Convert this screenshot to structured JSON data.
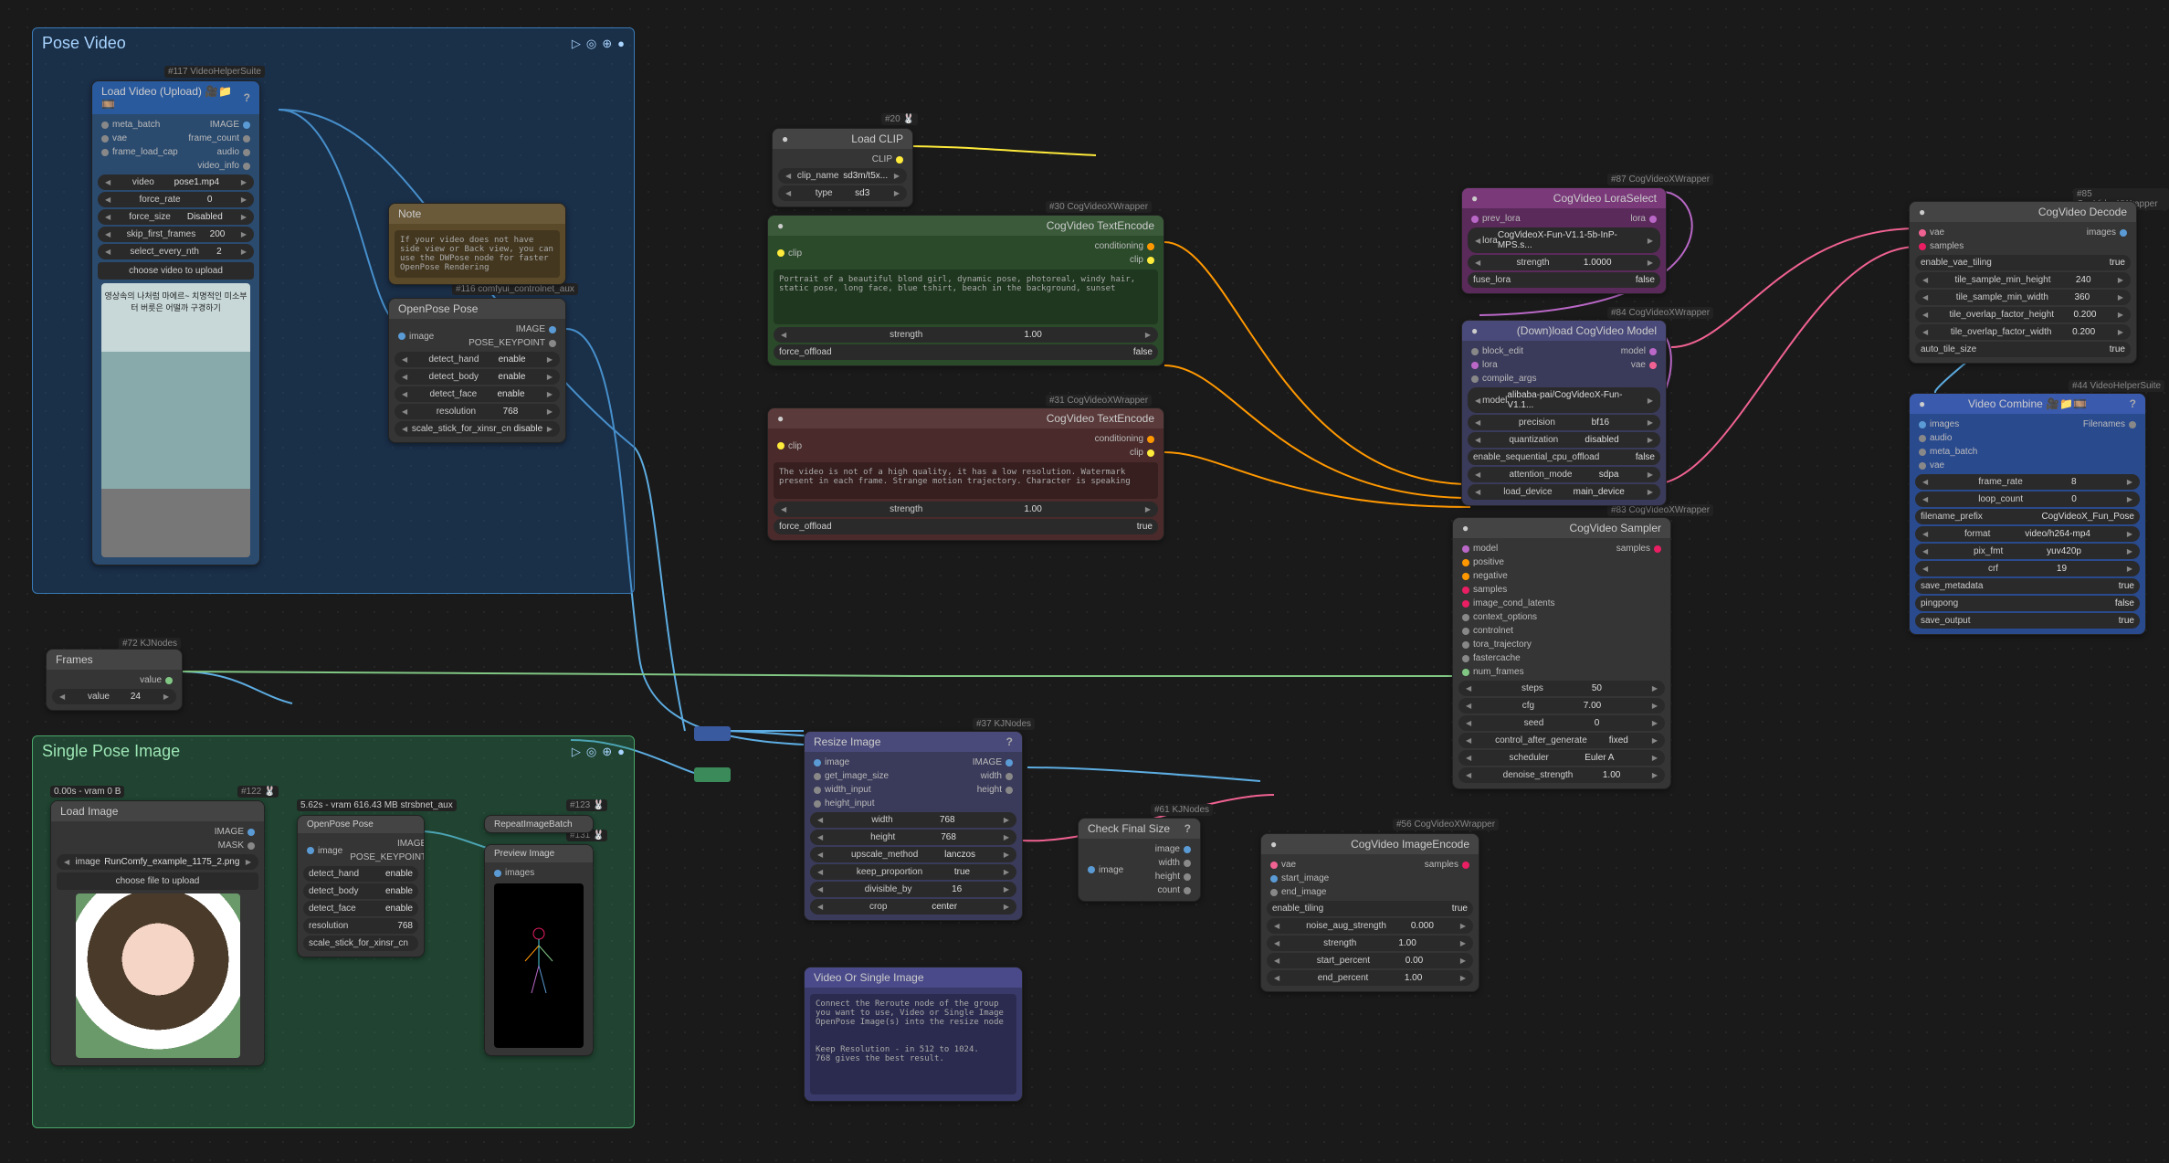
{
  "groups": {
    "pose_video": {
      "title": "Pose Video",
      "ctrl": [
        "▷",
        "◎",
        "⊕",
        "●"
      ]
    },
    "single_pose": {
      "title": "Single Pose Image",
      "ctrl": [
        "▷",
        "◎",
        "⊕",
        "●"
      ]
    }
  },
  "tags": {
    "t117": "#117 VideoHelperSuite",
    "t116": "#116 comfyui_controlnet_aux",
    "t72": "#72 KJNodes",
    "t122": "#122 🐰",
    "t123": "#123 🐰",
    "t131": "#131 🐰",
    "t37": "#37 KJNodes",
    "t61": "#61 KJNodes",
    "t20": "#20 🐰",
    "t30": "#30 CogVideoXWrapper",
    "t31": "#31 CogVideoXWrapper",
    "t87": "#87 CogVideoXWrapper",
    "t84": "#84 CogVideoXWrapper",
    "t83": "#83 CogVideoXWrapper",
    "t56": "#56 CogVideoXWrapper",
    "t85": "#85 CogVideoXWrapper",
    "t44": "#44 VideoHelperSuite",
    "vram": "0.00s - vram 0 B",
    "vram2": "5.62s - vram 616.43 MB  strsbnet_aux"
  },
  "load_video": {
    "title": "Load Video (Upload) 🎥📁🎞️",
    "q": "?",
    "in": [
      "meta_batch",
      "vae",
      "frame_load_cap"
    ],
    "out": [
      "IMAGE",
      "frame_count",
      "audio",
      "video_info"
    ],
    "w": [
      [
        "video",
        "pose1.mp4"
      ],
      [
        "force_rate",
        "0"
      ],
      [
        "force_size",
        "Disabled"
      ],
      [
        "skip_first_frames",
        "200"
      ],
      [
        "select_every_nth",
        "2"
      ]
    ],
    "btn": "choose video to upload",
    "caption": "영상속의 나처럼 마에르~  치명적인 미소부터 버릇은 어떨까 구경하기"
  },
  "openpose1": {
    "title": "OpenPose Pose",
    "in": [
      "image"
    ],
    "out": [
      "IMAGE",
      "POSE_KEYPOINT"
    ],
    "w": [
      [
        "detect_hand",
        "enable"
      ],
      [
        "detect_body",
        "enable"
      ],
      [
        "detect_face",
        "enable"
      ],
      [
        "resolution",
        "768"
      ],
      [
        "scale_stick_for_xinsr_cn",
        "disable"
      ]
    ]
  },
  "note": {
    "title": "Note",
    "text": "If your video does not have side view or Back view, you can use the DWPose node for faster OpenPose Rendering"
  },
  "frames": {
    "title": "Frames",
    "out": [
      "value"
    ],
    "w": [
      [
        "value",
        "24"
      ]
    ]
  },
  "load_image": {
    "title": "Load Image",
    "out": [
      "IMAGE",
      "MASK"
    ],
    "w": [
      [
        "image",
        "RunComfy_example_1175_2.png"
      ]
    ],
    "btn": "choose file to upload"
  },
  "openpose2": {
    "title": "OpenPose Pose",
    "in": [
      "image"
    ],
    "out": [
      "IMAGE",
      "POSE_KEYPOINT"
    ],
    "w": [
      [
        "detect_hand",
        "enable"
      ],
      [
        "detect_body",
        "enable"
      ],
      [
        "detect_face",
        "enable"
      ],
      [
        "resolution",
        "768"
      ],
      [
        "scale_stick_for_xinsr_cn",
        " "
      ]
    ]
  },
  "repeat": {
    "title": "RepeatImageBatch"
  },
  "preview": {
    "title": "Preview Image",
    "in": [
      "images"
    ]
  },
  "resize": {
    "title": "Resize Image",
    "q": "?",
    "in": [
      "image",
      "get_image_size",
      "width_input",
      "height_input"
    ],
    "out": [
      "IMAGE",
      "width",
      "height"
    ],
    "w": [
      [
        "width",
        "768"
      ],
      [
        "height",
        "768"
      ],
      [
        "upscale_method",
        "lanczos"
      ],
      [
        "keep_proportion",
        "true"
      ],
      [
        "divisible_by",
        "16"
      ],
      [
        "crop",
        "center"
      ]
    ]
  },
  "check_size": {
    "title": "Check Final Size",
    "q": "?",
    "in": [
      "image"
    ],
    "out": [
      "image",
      "width",
      "height",
      "count"
    ]
  },
  "video_or": {
    "title": "Video Or Single Image",
    "text": "Connect the Reroute node of the group you want to use, Video or Single Image OpenPose Image(s) into the resize node\n\n\nKeep Resolution - in 512 to 1024.\n768 gives the best result."
  },
  "load_clip": {
    "title": "Load CLIP",
    "out": [
      "CLIP"
    ],
    "w": [
      [
        "clip_name",
        "sd3m/t5x..."
      ],
      [
        "type",
        "sd3"
      ]
    ]
  },
  "textenc1": {
    "title": "CogVideo TextEncode",
    "in": [
      "clip"
    ],
    "out": [
      "conditioning",
      "clip"
    ],
    "text": "Portrait of a beautiful blond girl, dynamic pose, photoreal, windy hair, static pose, long face, blue tshirt, beach in the background, sunset",
    "w": [
      [
        "strength",
        "1.00"
      ],
      [
        "force_offload",
        "false"
      ]
    ]
  },
  "textenc2": {
    "title": "CogVideo TextEncode",
    "in": [
      "clip"
    ],
    "out": [
      "conditioning",
      "clip"
    ],
    "text": "The video is not of a high quality, it has a low resolution. Watermark present in each frame. Strange motion trajectory. Character is speaking",
    "w": [
      [
        "strength",
        "1.00"
      ],
      [
        "force_offload",
        "true"
      ]
    ]
  },
  "lora": {
    "title": "CogVideo LoraSelect",
    "in": [
      "prev_lora"
    ],
    "out": [
      "lora"
    ],
    "w": [
      [
        "lora",
        "CogVideoX-Fun-V1.1-5b-InP-MPS.s..."
      ],
      [
        "strength",
        "1.0000"
      ],
      [
        "fuse_lora",
        "false"
      ]
    ]
  },
  "dlmodel": {
    "title": "(Down)load CogVideo Model",
    "in": [
      "block_edit",
      "lora",
      "compile_args"
    ],
    "out": [
      "model",
      "vae"
    ],
    "w": [
      [
        "model",
        "alibaba-pai/CogVideoX-Fun-V1.1..."
      ],
      [
        "precision",
        "bf16"
      ],
      [
        "quantization",
        "disabled"
      ],
      [
        "enable_sequential_cpu_offload",
        "false"
      ],
      [
        "attention_mode",
        "sdpa"
      ],
      [
        "load_device",
        "main_device"
      ]
    ]
  },
  "sampler": {
    "title": "CogVideo Sampler",
    "in": [
      "model",
      "positive",
      "negative",
      "samples",
      "image_cond_latents",
      "context_options",
      "controlnet",
      "tora_trajectory",
      "fastercache",
      "num_frames"
    ],
    "out": [
      "samples"
    ],
    "w": [
      [
        "steps",
        "50"
      ],
      [
        "cfg",
        "7.00"
      ],
      [
        "seed",
        "0"
      ],
      [
        "control_after_generate",
        "fixed"
      ],
      [
        "scheduler",
        "Euler A"
      ],
      [
        "denoise_strength",
        "1.00"
      ]
    ]
  },
  "imgenc": {
    "title": "CogVideo ImageEncode",
    "in": [
      "vae",
      "start_image",
      "end_image"
    ],
    "out": [
      "samples"
    ],
    "w": [
      [
        "enable_tiling",
        "true"
      ],
      [
        "noise_aug_strength",
        "0.000"
      ],
      [
        "strength",
        "1.00"
      ],
      [
        "start_percent",
        "0.00"
      ],
      [
        "end_percent",
        "1.00"
      ]
    ]
  },
  "decode": {
    "title": "CogVideo Decode",
    "in": [
      "vae",
      "samples"
    ],
    "out": [
      "images"
    ],
    "w": [
      [
        "enable_vae_tiling",
        "true"
      ],
      [
        "tile_sample_min_height",
        "240"
      ],
      [
        "tile_sample_min_width",
        "360"
      ],
      [
        "tile_overlap_factor_height",
        "0.200"
      ],
      [
        "tile_overlap_factor_width",
        "0.200"
      ],
      [
        "auto_tile_size",
        "true"
      ]
    ]
  },
  "combine": {
    "title": "Video Combine 🎥📁🎞️",
    "q": "?",
    "in": [
      "images",
      "audio",
      "meta_batch",
      "vae"
    ],
    "out": [
      "Filenames"
    ],
    "w": [
      [
        "frame_rate",
        "8"
      ],
      [
        "loop_count",
        "0"
      ],
      [
        "filename_prefix",
        "CogVideoX_Fun_Pose"
      ],
      [
        "format",
        "video/h264-mp4"
      ],
      [
        "pix_fmt",
        "yuv420p"
      ],
      [
        "crf",
        "19"
      ],
      [
        "save_metadata",
        "true"
      ],
      [
        "pingpong",
        "false"
      ],
      [
        "save_output",
        "true"
      ]
    ]
  }
}
